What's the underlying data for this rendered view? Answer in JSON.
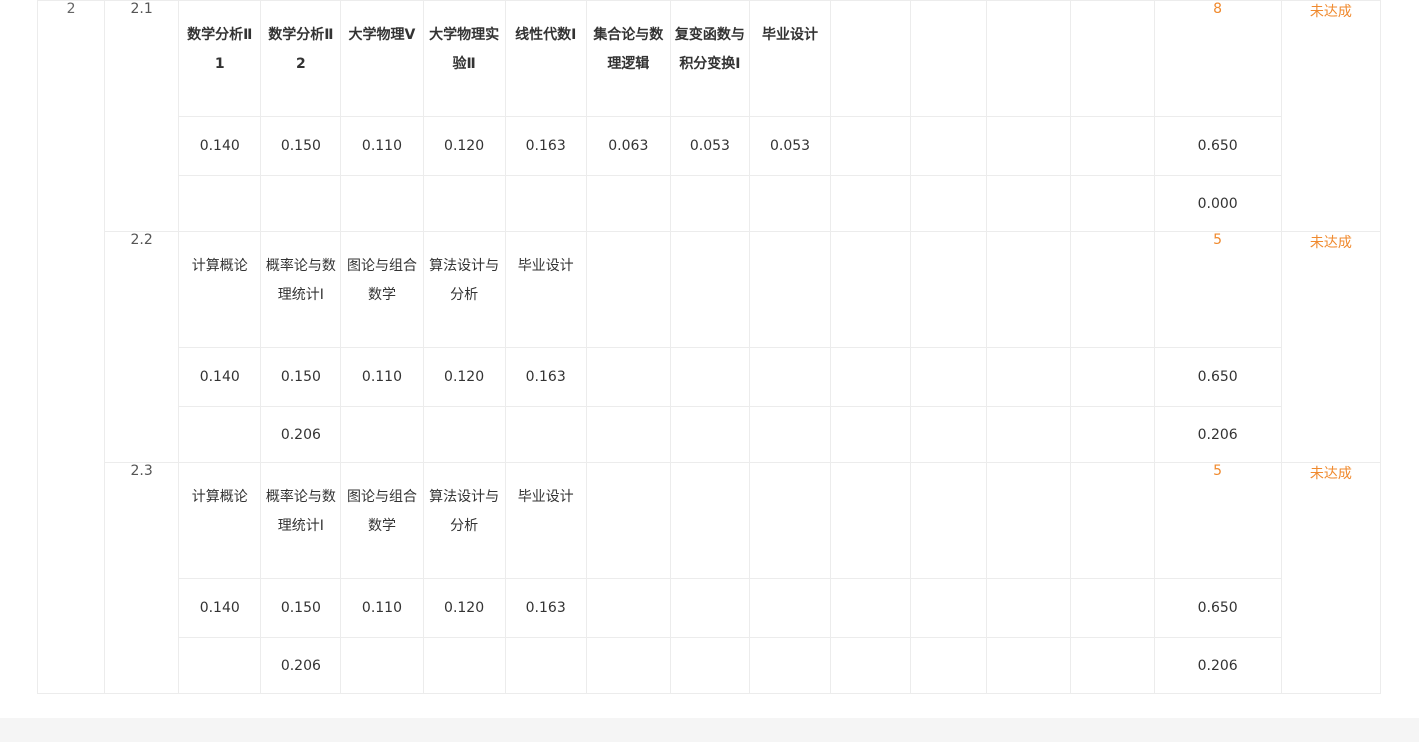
{
  "group": {
    "number": "2"
  },
  "groups": [
    {
      "index": "2.1",
      "courses": [
        "数学分析Ⅱ1",
        "数学分析Ⅱ2",
        "大学物理Ⅴ",
        "大学物理实验Ⅱ",
        "线性代数Ⅰ",
        "集合论与数理逻辑",
        "复变函数与积分变换Ⅰ",
        "毕业设计"
      ],
      "weights": [
        "0.140",
        "0.150",
        "0.110",
        "0.120",
        "0.163",
        "0.063",
        "0.053",
        "0.053"
      ],
      "scores": [
        "",
        "",
        "",
        "",
        "",
        "",
        "",
        ""
      ],
      "count": "8",
      "weight_sum": "0.650",
      "score_sum": "0.000",
      "status": "未达成"
    },
    {
      "index": "2.2",
      "courses": [
        "计算概论",
        "概率论与数理统计Ⅰ",
        "图论与组合数学",
        "算法设计与分析",
        "毕业设计"
      ],
      "weights": [
        "0.140",
        "0.150",
        "0.110",
        "0.120",
        "0.163"
      ],
      "scores": [
        "",
        "0.206",
        "",
        "",
        ""
      ],
      "count": "5",
      "weight_sum": "0.650",
      "score_sum": "0.206",
      "status": "未达成"
    },
    {
      "index": "2.3",
      "courses": [
        "计算概论",
        "概率论与数理统计Ⅰ",
        "图论与组合数学",
        "算法设计与分析",
        "毕业设计"
      ],
      "weights": [
        "0.140",
        "0.150",
        "0.110",
        "0.120",
        "0.163"
      ],
      "scores": [
        "",
        "0.206",
        "",
        "",
        ""
      ],
      "count": "5",
      "weight_sum": "0.650",
      "score_sum": "0.206",
      "status": "未达成"
    }
  ],
  "colors": {
    "accent": "#f08a2e",
    "border": "#ececec"
  }
}
